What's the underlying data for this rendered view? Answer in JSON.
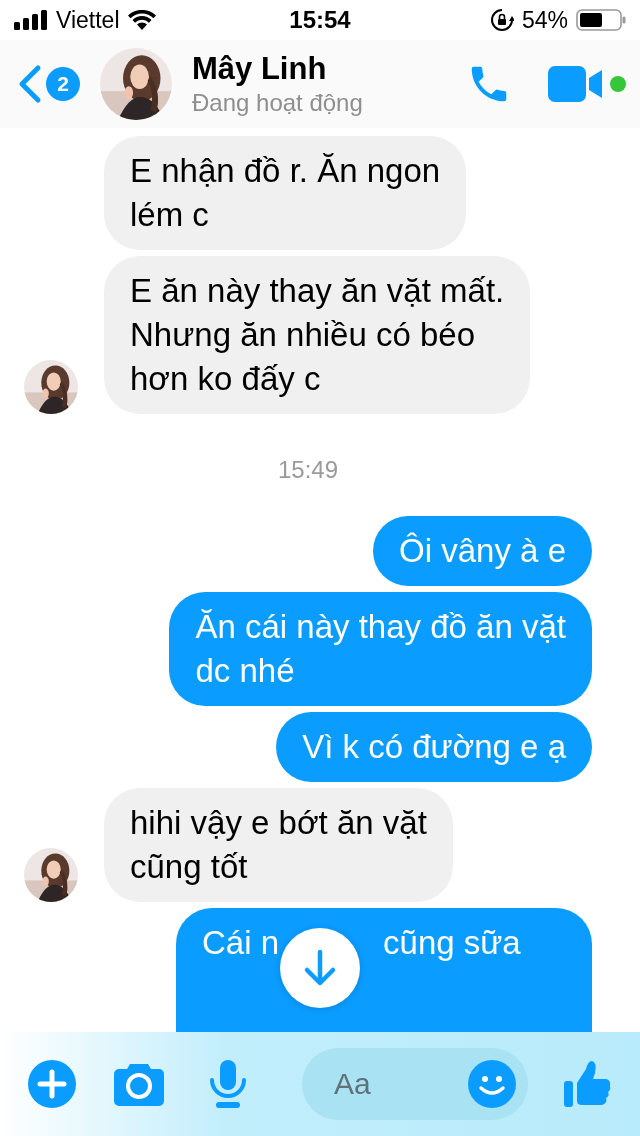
{
  "status_bar": {
    "carrier": "Viettel",
    "time": "15:54",
    "battery_percent": "54%"
  },
  "header": {
    "unread_count": "2",
    "name": "Mây Linh",
    "status": "Đang hoạt động",
    "online": true
  },
  "messages": [
    {
      "kind": "incoming",
      "text": "E nhận đồ r. Ăn ngon\nlém c",
      "avatar": false
    },
    {
      "kind": "incoming",
      "text": "E ăn này thay ăn vặt mất.\nNhưng ăn nhiều có béo\nhơn ko đấy c",
      "avatar": true
    },
    {
      "kind": "timestamp",
      "text": "15:49"
    },
    {
      "kind": "outgoing",
      "text": "Ôi vâny à e"
    },
    {
      "kind": "outgoing",
      "text": "Ăn cái này thay đồ ăn vặt\ndc nhé"
    },
    {
      "kind": "outgoing",
      "text": "Vì k có đường e ạ"
    },
    {
      "kind": "incoming",
      "text": "hihi vậy e bớt ăn vặt\ncũng tốt",
      "avatar": true
    },
    {
      "kind": "outgoing_partial",
      "text_parts": [
        "Cái n",
        "cũng sữa"
      ]
    }
  ],
  "composer": {
    "placeholder": "Aa"
  }
}
